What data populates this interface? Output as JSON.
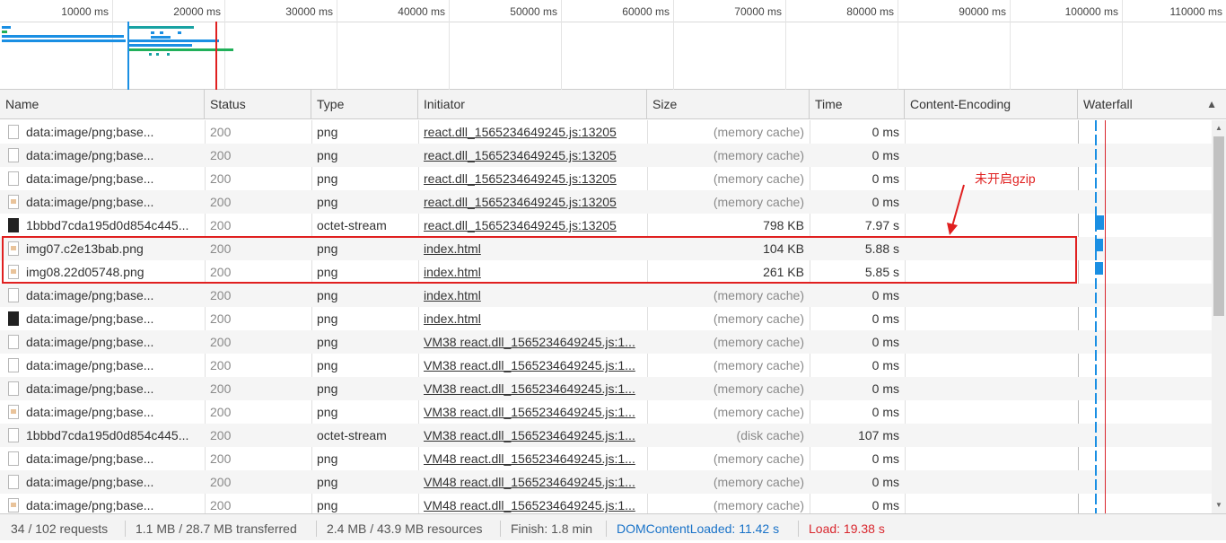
{
  "overview": {
    "ticks": [
      "10000 ms",
      "20000 ms",
      "30000 ms",
      "40000 ms",
      "50000 ms",
      "60000 ms",
      "70000 ms",
      "80000 ms",
      "90000 ms",
      "100000 ms",
      "110000 ms"
    ],
    "colors": {
      "blue": "#1a8fe3",
      "green": "#21b05a",
      "red": "#e02020",
      "teal": "#19a2a2"
    }
  },
  "columns": {
    "name": "Name",
    "status": "Status",
    "type": "Type",
    "initiator": "Initiator",
    "size": "Size",
    "time": "Time",
    "encoding": "Content-Encoding",
    "waterfall": "Waterfall"
  },
  "rows": [
    {
      "name": "data:image/png;base...",
      "status": "200",
      "type": "png",
      "initiator": "react.dll_1565234649245.js:13205",
      "size": "(memory cache)",
      "time": "0 ms",
      "encoding": "",
      "icon": "file-icon"
    },
    {
      "name": "data:image/png;base...",
      "status": "200",
      "type": "png",
      "initiator": "react.dll_1565234649245.js:13205",
      "size": "(memory cache)",
      "time": "0 ms",
      "encoding": "",
      "icon": "file-icon"
    },
    {
      "name": "data:image/png;base...",
      "status": "200",
      "type": "png",
      "initiator": "react.dll_1565234649245.js:13205",
      "size": "(memory cache)",
      "time": "0 ms",
      "encoding": "",
      "icon": "file-icon"
    },
    {
      "name": "data:image/png;base...",
      "status": "200",
      "type": "png",
      "initiator": "react.dll_1565234649245.js:13205",
      "size": "(memory cache)",
      "time": "0 ms",
      "encoding": "",
      "icon": "image-thumb-icon"
    },
    {
      "name": "1bbbd7cda195d0d854c445...",
      "status": "200",
      "type": "octet-stream",
      "initiator": "react.dll_1565234649245.js:13205",
      "size": "798 KB",
      "time": "7.97 s",
      "encoding": "",
      "icon": "black-thumb-icon"
    },
    {
      "name": "img07.c2e13bab.png",
      "status": "200",
      "type": "png",
      "initiator": "index.html",
      "size": "104 KB",
      "time": "5.88 s",
      "encoding": "",
      "icon": "image-thumb-icon"
    },
    {
      "name": "img08.22d05748.png",
      "status": "200",
      "type": "png",
      "initiator": "index.html",
      "size": "261 KB",
      "time": "5.85 s",
      "encoding": "",
      "icon": "image-thumb-icon"
    },
    {
      "name": "data:image/png;base...",
      "status": "200",
      "type": "png",
      "initiator": "index.html",
      "size": "(memory cache)",
      "time": "0 ms",
      "encoding": "",
      "icon": "file-icon"
    },
    {
      "name": "data:image/png;base...",
      "status": "200",
      "type": "png",
      "initiator": "index.html",
      "size": "(memory cache)",
      "time": "0 ms",
      "encoding": "",
      "icon": "black-thumb-icon"
    },
    {
      "name": "data:image/png;base...",
      "status": "200",
      "type": "png",
      "initiator": "VM38 react.dll_1565234649245.js:1...",
      "size": "(memory cache)",
      "time": "0 ms",
      "encoding": "",
      "icon": "file-icon"
    },
    {
      "name": "data:image/png;base...",
      "status": "200",
      "type": "png",
      "initiator": "VM38 react.dll_1565234649245.js:1...",
      "size": "(memory cache)",
      "time": "0 ms",
      "encoding": "",
      "icon": "file-icon"
    },
    {
      "name": "data:image/png;base...",
      "status": "200",
      "type": "png",
      "initiator": "VM38 react.dll_1565234649245.js:1...",
      "size": "(memory cache)",
      "time": "0 ms",
      "encoding": "",
      "icon": "file-icon"
    },
    {
      "name": "data:image/png;base...",
      "status": "200",
      "type": "png",
      "initiator": "VM38 react.dll_1565234649245.js:1...",
      "size": "(memory cache)",
      "time": "0 ms",
      "encoding": "",
      "icon": "image-thumb-icon"
    },
    {
      "name": "1bbbd7cda195d0d854c445...",
      "status": "200",
      "type": "octet-stream",
      "initiator": "VM38 react.dll_1565234649245.js:1...",
      "size": "(disk cache)",
      "time": "107 ms",
      "encoding": "",
      "icon": "file-icon"
    },
    {
      "name": "data:image/png;base...",
      "status": "200",
      "type": "png",
      "initiator": "VM48 react.dll_1565234649245.js:1...",
      "size": "(memory cache)",
      "time": "0 ms",
      "encoding": "",
      "icon": "file-icon"
    },
    {
      "name": "data:image/png;base...",
      "status": "200",
      "type": "png",
      "initiator": "VM48 react.dll_1565234649245.js:1...",
      "size": "(memory cache)",
      "time": "0 ms",
      "encoding": "",
      "icon": "file-icon"
    },
    {
      "name": "data:image/png;base...",
      "status": "200",
      "type": "png",
      "initiator": "VM48 react.dll_1565234649245.js:1...",
      "size": "(memory cache)",
      "time": "0 ms",
      "encoding": "",
      "icon": "image-thumb-icon"
    }
  ],
  "annotation": {
    "text": "未开启gzip",
    "color": "#e02020"
  },
  "status_bar": {
    "requests": "34 / 102 requests",
    "transferred": "1.1 MB / 28.7 MB transferred",
    "resources": "2.4 MB / 43.9 MB resources",
    "finish": "Finish: 1.8 min",
    "dom_content_loaded": "DOMContentLoaded: 11.42 s",
    "load": "Load: 19.38 s",
    "dom_color": "#1a73c8",
    "load_color": "#d9272e"
  }
}
